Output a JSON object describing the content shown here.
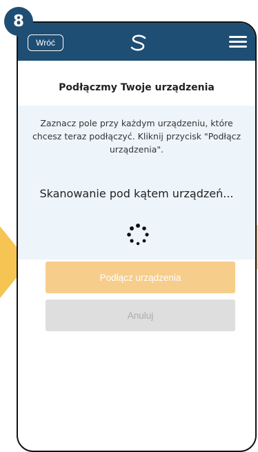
{
  "step": {
    "number": "8"
  },
  "header": {
    "back_label": "Wróć",
    "logo_icon": "brand-s-logo-icon",
    "menu_icon": "hamburger-menu-icon"
  },
  "page": {
    "title": "Podłączmy Twoje urządzenia",
    "instructions_line1": "Zaznacz pole przy każdym urządzeniu, które",
    "instructions_line2": "chcesz teraz podłączyć. Kliknij przycisk \"Podłącz",
    "instructions_line3": "urządzenia\".",
    "scanning_text": "Skanowanie pod kątem urządzeń...",
    "spinner_icon": "loading-spinner-icon"
  },
  "actions": {
    "connect_label": "Podłącz urządzenia",
    "cancel_label": "Anuluj"
  },
  "colors": {
    "header_bg": "#1f4e74",
    "panel_bg": "#edf5fb",
    "connect_bg": "#f6cd8a",
    "cancel_bg": "#dedede",
    "arrow": "#f5c452"
  }
}
